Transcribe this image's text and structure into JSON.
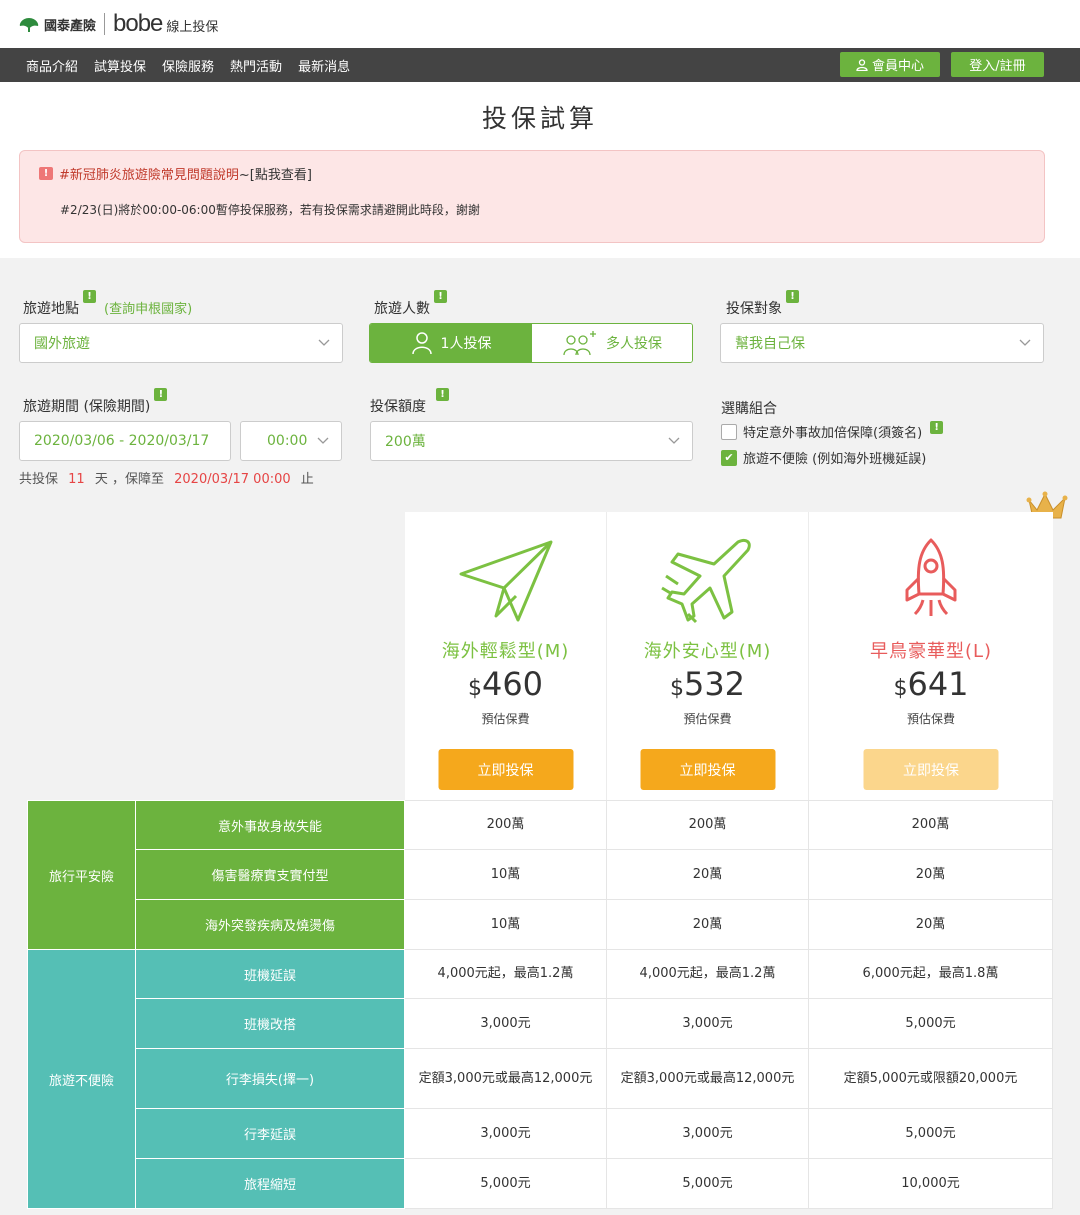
{
  "header": {
    "brand": "國泰產險",
    "bobe": "bobe",
    "bobe_sub": "線上投保"
  },
  "nav": {
    "items": [
      "商品介紹",
      "試算投保",
      "保險服務",
      "熱門活動",
      "最新消息"
    ],
    "member": "會員中心",
    "login": "登入/註冊"
  },
  "page_title": "投保試算",
  "notice": {
    "link_text": "#新冠肺炎旅遊險常見問題說明",
    "link_suffix": "~[點我查看]",
    "message": "#2/23(日)將於00:00-06:00暫停投保服務，若有投保需求請避開此時段，謝謝"
  },
  "form": {
    "destination_label": "旅遊地點",
    "destination_hint": "(查詢申根國家)",
    "destination_value": "國外旅遊",
    "travelers_label": "旅遊人數",
    "single": "1人投保",
    "multi": "多人投保",
    "insured_label": "投保對象",
    "insured_value": "幫我自己保",
    "period_label": "旅遊期間 (保險期間)",
    "period_value": "2020/03/06 - 2020/03/17",
    "time_value": "00:00",
    "amount_label": "投保額度",
    "amount_value": "200萬",
    "combo_label": "選購組合",
    "addon1": "特定意外事故加倍保障(須簽名)",
    "addon2": "旅遊不便險 (例如海外班機延誤)",
    "period_info": {
      "prefix": "共投保",
      "days": "11",
      "days_unit": "天 ，保障至",
      "end": "2020/03/17 00:00",
      "suffix": "止"
    }
  },
  "plans": [
    {
      "name": "海外輕鬆型(M)",
      "currency": "$",
      "price": "460",
      "est": "預估保費",
      "buy": "立即投保",
      "color": "#7cc142"
    },
    {
      "name": "海外安心型(M)",
      "currency": "$",
      "price": "532",
      "est": "預估保費",
      "buy": "立即投保",
      "color": "#7cc142"
    },
    {
      "name": "早鳥豪華型(L)",
      "currency": "$",
      "price": "641",
      "est": "預估保費",
      "buy": "立即投保",
      "color": "#e85c5c"
    }
  ],
  "table": {
    "group1": "旅行平安險",
    "group2": "旅遊不便險",
    "rows": [
      {
        "item": "意外事故身故失能",
        "v": [
          "200萬",
          "200萬",
          "200萬"
        ]
      },
      {
        "item": "傷害醫療實支實付型",
        "v": [
          "10萬",
          "20萬",
          "20萬"
        ]
      },
      {
        "item": "海外突發疾病及燒燙傷",
        "v": [
          "10萬",
          "20萬",
          "20萬"
        ]
      },
      {
        "item": "班機延誤",
        "v": [
          "4,000元起，最高1.2萬",
          "4,000元起，最高1.2萬",
          "6,000元起，最高1.8萬"
        ]
      },
      {
        "item": "班機改搭",
        "v": [
          "3,000元",
          "3,000元",
          "5,000元"
        ]
      },
      {
        "item": "行李損失(擇一)",
        "v": [
          "定額3,000元或最高12,000元",
          "定額3,000元或最高12,000元",
          "定額5,000元或限額20,000元"
        ]
      },
      {
        "item": "行李延誤",
        "v": [
          "3,000元",
          "3,000元",
          "5,000元"
        ]
      },
      {
        "item": "旅程縮短",
        "v": [
          "5,000元",
          "5,000元",
          "10,000元"
        ]
      }
    ]
  }
}
